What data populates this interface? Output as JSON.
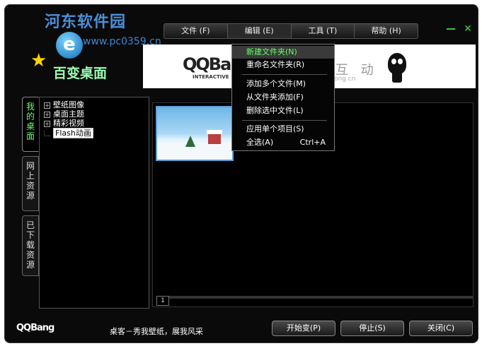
{
  "watermark": {
    "title": "河东软件园",
    "url": "www.pc0359.cn"
  },
  "app": {
    "logo_glyph": "e",
    "title": "百变桌面",
    "logo_icon": "e-logo-icon",
    "brand": "QQBang"
  },
  "menu": [
    {
      "label": "文件 (F)"
    },
    {
      "label": "编辑 (E)"
    },
    {
      "label": "工具 (T)"
    },
    {
      "label": "帮助 (H)"
    }
  ],
  "window_buttons": {
    "minimize": "—",
    "close": "✕"
  },
  "banner": {
    "logo_text": "QQBang",
    "logo_sub": "INTERACTIVE",
    "hudong": "互 动",
    "site": "olong.cn"
  },
  "side_tabs": [
    {
      "label": "我的桌面",
      "active": true
    },
    {
      "label": "网上资源",
      "active": false
    },
    {
      "label": "已下载资源",
      "active": false
    }
  ],
  "tree": [
    {
      "label": "壁纸图像",
      "expander": "+"
    },
    {
      "label": "桌面主题",
      "expander": "+"
    },
    {
      "label": "精彩视频",
      "expander": "+"
    },
    {
      "label": "Flash动画",
      "expander": ""
    }
  ],
  "page_number": "1",
  "dropdown": {
    "items": [
      {
        "label": "新建文件夹(N)",
        "shortcut": ""
      },
      {
        "label": "重命名文件夹(R)",
        "shortcut": ""
      },
      {
        "label": "添加多个文件(M)",
        "shortcut": ""
      },
      {
        "label": "从文件夹添加(F)",
        "shortcut": ""
      },
      {
        "label": "删除选中文件(L)",
        "shortcut": ""
      },
      {
        "label": "应用单个项目(S)",
        "shortcut": ""
      },
      {
        "label": "全选(A)",
        "shortcut": "Ctrl+A"
      }
    ]
  },
  "footer": {
    "logo": "QQBang",
    "slogan": "桌客－秀我壁纸，展我风采",
    "buttons": {
      "start": "开始变(P)",
      "stop": "停止(S)",
      "close": "关闭(C)"
    }
  },
  "colors": {
    "accent_green": "#6aff6a",
    "background": "#0a0a0a",
    "menu_highlight": "#3a3a3a"
  }
}
